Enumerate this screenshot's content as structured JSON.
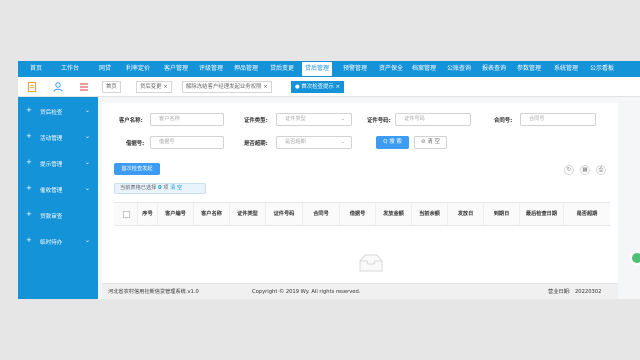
{
  "top_nav": {
    "items": [
      "首页",
      "工作台",
      "网贷",
      "利率定价",
      "客户管理",
      "评级管理",
      "押品管理",
      "贷后变更",
      "贷后管理",
      "预警管理",
      "资产保全",
      "档案管理",
      "公账查询",
      "报表查询",
      "参数管理",
      "系统管理",
      "公示看板"
    ],
    "active_index": 8
  },
  "sidebar": {
    "items": [
      "贷后检查",
      "活动管理",
      "提示管理",
      "催收管理",
      "贷款审查",
      "临时待办"
    ]
  },
  "tabs": [
    {
      "label": "首页",
      "close": ""
    },
    {
      "label": "贷后变更",
      "close": "×"
    },
    {
      "label": "解除冻结客户经理发起业务权限",
      "close": "×"
    },
    {
      "label": "● 首次检查提示",
      "close": "×"
    }
  ],
  "form": {
    "customer_name_label": "客户名称:",
    "customer_name_placeholder": "客户名称",
    "id_type_label": "证件类型:",
    "id_type_placeholder": "证件类型",
    "id_number_label": "证件号码:",
    "id_number_placeholder": "证件号码",
    "contract_label": "合同号:",
    "contract_placeholder": "合同号",
    "receipt_label": "借据号:",
    "receipt_placeholder": "借据号",
    "overdue_label": "是否超期:",
    "overdue_placeholder": "是否超期",
    "search_label": "Q 搜 索",
    "reset_label": "⊘ 清 空"
  },
  "toolbar": {
    "launch_label": "首次检查发起",
    "refresh_icon": "↻",
    "grid_icon": "▦",
    "print_icon": "⎙"
  },
  "selection": {
    "prefix": "当前表格已选择",
    "count": "0",
    "suffix": "项",
    "clear": "清 空"
  },
  "table": {
    "columns": [
      "序号",
      "客户编号",
      "客户名称",
      "证件类型",
      "证件号码",
      "合同号",
      "借据号",
      "发放金额",
      "当前余额",
      "发放日",
      "到期日",
      "最后检查日期",
      "是否超期"
    ]
  },
  "footer": {
    "system_name": "河北省农村信用社新信贷管理系统.v1.0",
    "copyright": "Copyright © 2019 Wy. All rights reserved.",
    "business_date_label": "营业日期:",
    "business_date": "20220302"
  },
  "colors": {
    "primary": "#1593d8",
    "button_blue": "#3d9cf2"
  }
}
